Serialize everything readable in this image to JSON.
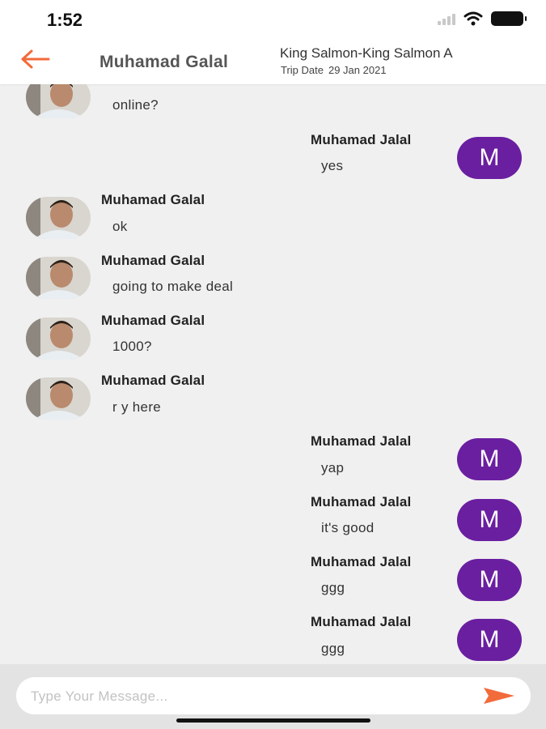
{
  "status_bar": {
    "time": "1:52",
    "icons": [
      "signal-icon",
      "wifi-icon",
      "battery-icon"
    ]
  },
  "header": {
    "back_icon": "arrow-left-icon",
    "contact_name": "Muhamad Galal",
    "route": "King Salmon-King Salmon A",
    "trip_date_label": "Trip Date",
    "trip_date_value": "29 Jan 2021"
  },
  "messages": [
    {
      "side": "left",
      "sender": "",
      "text": "online?"
    },
    {
      "side": "right",
      "sender": "Muhamad Jalal",
      "text": "yes",
      "avatar_initial": "M"
    },
    {
      "side": "left",
      "sender": "Muhamad Galal",
      "text": "ok"
    },
    {
      "side": "left",
      "sender": "Muhamad Galal",
      "text": "going to make deal"
    },
    {
      "side": "left",
      "sender": "Muhamad Galal",
      "text": "1000?"
    },
    {
      "side": "left",
      "sender": "Muhamad Galal",
      "text": "r y here"
    },
    {
      "side": "right",
      "sender": "Muhamad Jalal",
      "text": "yap",
      "avatar_initial": "M"
    },
    {
      "side": "right",
      "sender": "Muhamad Jalal",
      "text": "it's good",
      "avatar_initial": "M"
    },
    {
      "side": "right",
      "sender": "Muhamad Jalal",
      "text": "ggg",
      "avatar_initial": "M"
    },
    {
      "side": "right",
      "sender": "Muhamad Jalal",
      "text": "ggg",
      "avatar_initial": "M"
    }
  ],
  "composer": {
    "placeholder": "Type Your Message...",
    "send_icon": "send-icon"
  },
  "colors": {
    "accent": "#f26b3a",
    "avatar_purple": "#6a1fa0",
    "chat_bg": "#f0f0f0",
    "footer_bg": "#e3e3e3"
  }
}
